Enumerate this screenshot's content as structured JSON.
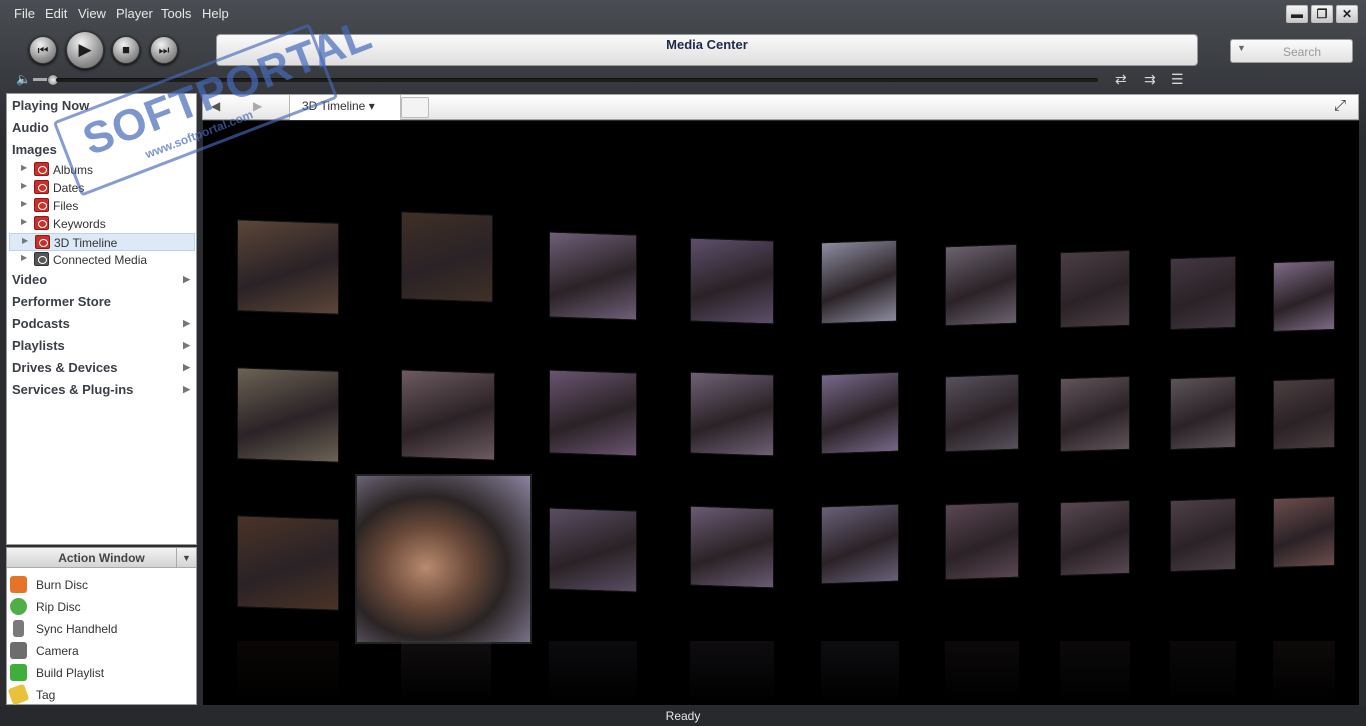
{
  "menu": [
    "File",
    "Edit",
    "View",
    "Player",
    "Tools",
    "Help"
  ],
  "window_buttons": {
    "minimize": "▬",
    "restore": "❐",
    "close": "✕"
  },
  "display": {
    "title": "Media Center"
  },
  "search": {
    "placeholder": "Search"
  },
  "transport": {
    "prev": "⏮",
    "play": "▶",
    "stop": "■",
    "next": "⏭"
  },
  "sidebar": {
    "items": [
      {
        "label": "Playing Now"
      },
      {
        "label": "Audio"
      },
      {
        "label": "Images"
      }
    ],
    "image_children": [
      {
        "label": "Albums"
      },
      {
        "label": "Dates"
      },
      {
        "label": "Files"
      },
      {
        "label": "Keywords"
      },
      {
        "label": "3D Timeline",
        "selected": true
      },
      {
        "label": "Connected Media"
      }
    ],
    "more_items": [
      {
        "label": "Video"
      },
      {
        "label": "Performer Store"
      },
      {
        "label": "Podcasts"
      },
      {
        "label": "Playlists"
      },
      {
        "label": "Drives & Devices"
      },
      {
        "label": "Services & Plug-ins"
      }
    ]
  },
  "action_window": {
    "title": "Action Window",
    "items": [
      {
        "label": "Burn Disc",
        "icon": "burn-disc-icon",
        "color": "#e5732a"
      },
      {
        "label": "Rip Disc",
        "icon": "rip-disc-icon",
        "color": "#4fae48"
      },
      {
        "label": "Sync Handheld",
        "icon": "handheld-icon",
        "color": "#7a7a7a"
      },
      {
        "label": "Camera",
        "icon": "camera-icon",
        "color": "#6d6d6d"
      },
      {
        "label": "Build Playlist",
        "icon": "playlist-icon",
        "color": "#3fae3a"
      },
      {
        "label": "Tag",
        "icon": "tag-icon",
        "color": "#e8c23a"
      }
    ]
  },
  "view_tab": {
    "label": "3D Timeline ▾"
  },
  "status": {
    "text": "Ready"
  },
  "watermark": {
    "main": "SOFTPORTAL",
    "sub": "www.softportal.com"
  },
  "photo_colors": [
    [
      "#5c4638",
      "#3f3026",
      "#6f5f78",
      "#5d4f6c",
      "#8d8ca0",
      "#6b6270",
      "#4a3e44",
      "#433844",
      "#7e6a86"
    ],
    [
      "#6b6353",
      "#6d5a60",
      "#6a5470",
      "#6f6176",
      "#76688a",
      "#58505c",
      "#61545a",
      "#5c5458",
      "#4b3e40"
    ],
    [
      "#4a3326",
      "#7a6672",
      "#5a4d63",
      "#6a5b74",
      "#6a607a",
      "#5a4652",
      "#584852",
      "#4e4048",
      "#6b4c4c"
    ]
  ]
}
